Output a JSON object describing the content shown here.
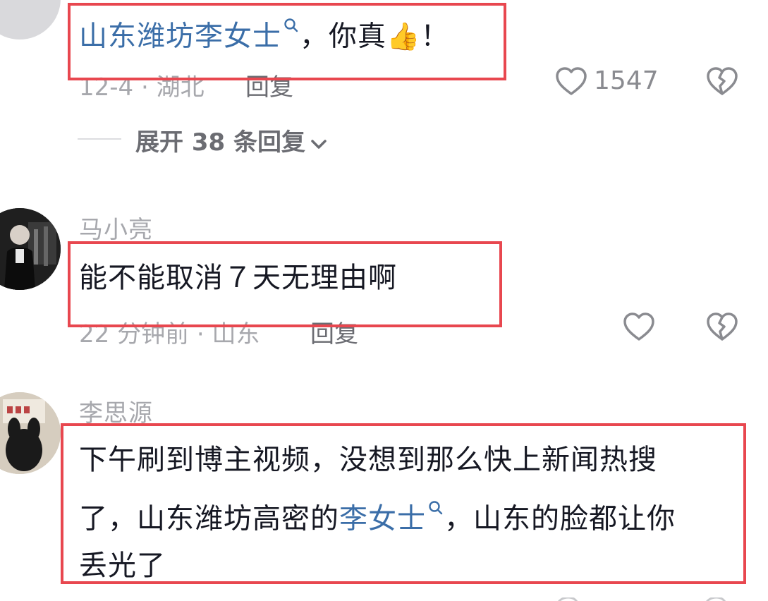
{
  "comments": [
    {
      "username": "",
      "mention": "山东潍坊李女士",
      "text_after": "，你真",
      "emoji": "👍",
      "text_end": "！",
      "meta": "12-4 · 湖北",
      "reply_label": "回复",
      "like_count": "1547",
      "expand_label": "展开 38 条回复"
    },
    {
      "username": "马小亮",
      "text": "能不能取消７天无理由啊",
      "meta": "22 分钟前 · 山东",
      "reply_label": "回复"
    },
    {
      "username": "李思源",
      "line1": "下午刷到博主视频，没想到那么快上新闻热搜",
      "line2_before": "了，山东潍坊高密的",
      "line2_mention": "李女士",
      "line2_after": "，山东的脸都让你",
      "line3": "丢光了"
    }
  ],
  "colors": {
    "highlight_box": "#e8474f",
    "mention": "#3b6ea8",
    "muted_text": "#a7a8ad"
  }
}
